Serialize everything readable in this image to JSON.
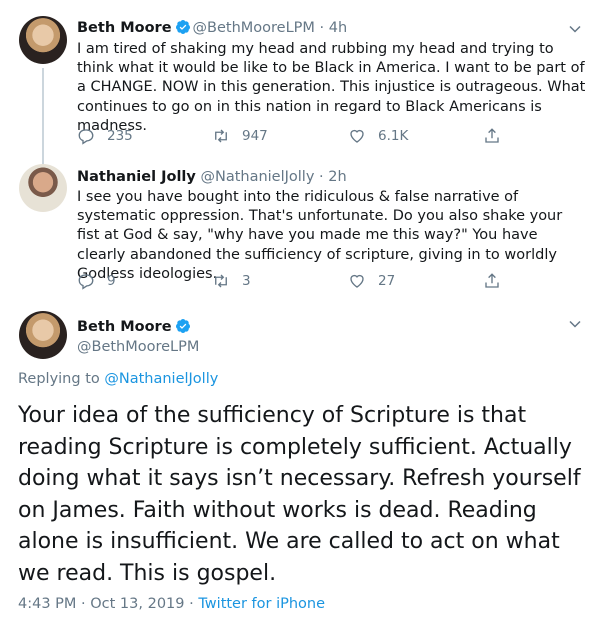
{
  "tweets": [
    {
      "name": "Beth Moore",
      "handle": "@BethMooreLPM",
      "time": "· 4h",
      "text": "I am tired of shaking my head and rubbing my head and trying to think what it would be like to be Black in America. I want to be part of a CHANGE. NOW in this generation. This injustice is outrageous. What continues to go on in this nation in regard to Black Americans is madness.",
      "replies": "235",
      "retweets": "947",
      "likes": "6.1K"
    },
    {
      "name": "Nathaniel Jolly",
      "handle": "@NathanielJolly",
      "time": "· 2h",
      "text": "I see you have bought into the ridiculous & false narrative of systematic oppression. That's unfortunate. Do you also shake your fist at God & say, \"why have you made me this way?\" You have clearly abandoned the sufficiency of scripture, giving in to worldly Godless ideologies.",
      "replies": "9",
      "retweets": "3",
      "likes": "27"
    }
  ],
  "main": {
    "name": "Beth Moore",
    "handle": "@BethMooreLPM",
    "replying_prefix": "Replying to",
    "replying_to": "@NathanielJolly",
    "text": "Your idea of the sufficiency of Scripture is that reading Scripture is completely sufficient. Actually doing what it says isn’t necessary. Refresh yourself on James. Faith without works is dead. Reading alone is insufficient. We are called to act on what we read. This is gospel.",
    "timestamp": "4:43 PM · Oct 13, 2019 ·",
    "source": "Twitter for iPhone"
  },
  "icons": {
    "reply": "reply-icon",
    "retweet": "retweet-icon",
    "like": "heart-icon",
    "share": "share-icon",
    "more": "chevron-down-icon",
    "verified": "verified-badge-icon"
  },
  "colors": {
    "link": "#1b95e0",
    "secondary": "#657786",
    "verified": "#1da1f2",
    "text": "#14171a"
  }
}
